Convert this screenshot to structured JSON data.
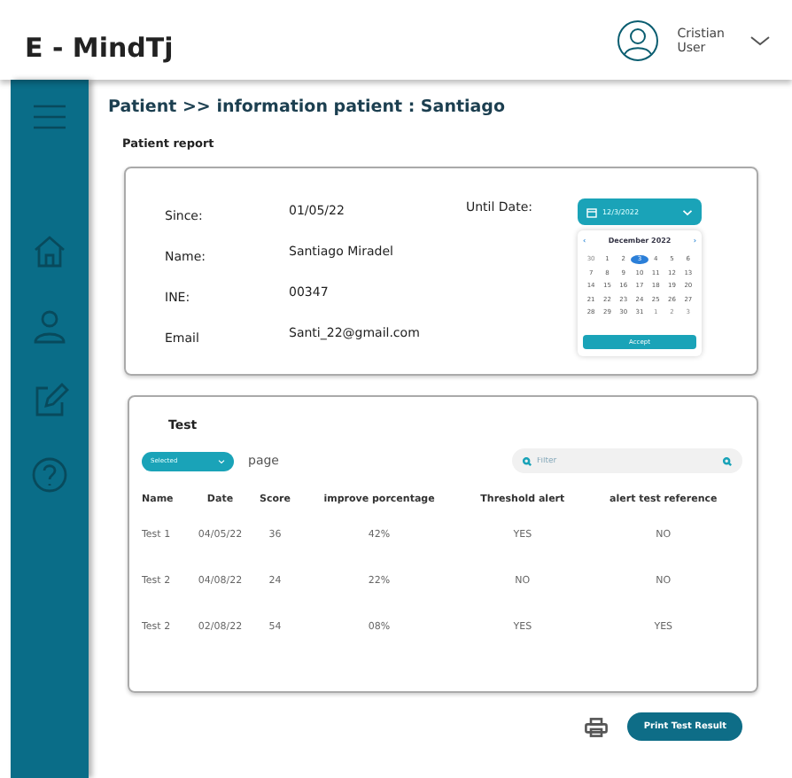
{
  "header": {
    "title": "E - MindTj",
    "user": {
      "name": "Cristian",
      "role": "User"
    }
  },
  "sidebar": {
    "items": [
      {
        "kind": "home"
      },
      {
        "kind": "person"
      },
      {
        "kind": "edit"
      },
      {
        "kind": "help"
      }
    ]
  },
  "breadcrumb": "Patient >> information patient : Santiago",
  "section_title": "Patient report",
  "patient": {
    "fields": [
      {
        "label": "Since:",
        "value": "01/05/22"
      },
      {
        "label": "Name:",
        "value": "Santiago Miradel"
      },
      {
        "label": "INE:",
        "value": "00347"
      },
      {
        "label": "Email",
        "value": "Santi_22@gmail.com"
      }
    ],
    "until_label": "Until Date:",
    "date_field": {
      "value": "12/3/2022"
    },
    "calendar": {
      "month": "December 2022",
      "prev": "‹",
      "next": "›",
      "days": [
        {
          "label": "30",
          "outside": true,
          "selected": false
        },
        {
          "label": "1",
          "outside": false,
          "selected": false
        },
        {
          "label": "2",
          "outside": false,
          "selected": false
        },
        {
          "label": "3",
          "outside": false,
          "selected": true
        },
        {
          "label": "4",
          "outside": false,
          "selected": false
        },
        {
          "label": "5",
          "outside": false,
          "selected": false
        },
        {
          "label": "6",
          "outside": false,
          "selected": false
        },
        {
          "label": "7",
          "outside": false,
          "selected": false
        },
        {
          "label": "8",
          "outside": false,
          "selected": false
        },
        {
          "label": "9",
          "outside": false,
          "selected": false
        },
        {
          "label": "10",
          "outside": false,
          "selected": false
        },
        {
          "label": "11",
          "outside": false,
          "selected": false
        },
        {
          "label": "12",
          "outside": false,
          "selected": false
        },
        {
          "label": "13",
          "outside": false,
          "selected": false
        },
        {
          "label": "14",
          "outside": false,
          "selected": false
        },
        {
          "label": "15",
          "outside": false,
          "selected": false
        },
        {
          "label": "16",
          "outside": false,
          "selected": false
        },
        {
          "label": "17",
          "outside": false,
          "selected": false
        },
        {
          "label": "18",
          "outside": false,
          "selected": false
        },
        {
          "label": "19",
          "outside": false,
          "selected": false
        },
        {
          "label": "20",
          "outside": false,
          "selected": false
        },
        {
          "label": "21",
          "outside": false,
          "selected": false
        },
        {
          "label": "22",
          "outside": false,
          "selected": false
        },
        {
          "label": "23",
          "outside": false,
          "selected": false
        },
        {
          "label": "24",
          "outside": false,
          "selected": false
        },
        {
          "label": "25",
          "outside": false,
          "selected": false
        },
        {
          "label": "26",
          "outside": false,
          "selected": false
        },
        {
          "label": "27",
          "outside": false,
          "selected": false
        },
        {
          "label": "28",
          "outside": false,
          "selected": false
        },
        {
          "label": "29",
          "outside": false,
          "selected": false
        },
        {
          "label": "30",
          "outside": false,
          "selected": false
        },
        {
          "label": "31",
          "outside": false,
          "selected": false
        },
        {
          "label": "1",
          "outside": true,
          "selected": false
        },
        {
          "label": "2",
          "outside": true,
          "selected": false
        },
        {
          "label": "3",
          "outside": true,
          "selected": false
        }
      ],
      "accept": "Accept"
    }
  },
  "tests": {
    "title": "Test",
    "page_select": "Selected",
    "page_label": "page",
    "filter": {
      "placeholder": "Filter"
    },
    "columns": [
      "Name",
      "Date",
      "Score",
      "improve porcentage",
      "Threshold alert",
      "alert test reference"
    ],
    "rows": [
      [
        "Test 1",
        "04/05/22",
        "36",
        "42%",
        "YES",
        "NO"
      ],
      [
        "Test 2",
        "04/08/22",
        "24",
        "22%",
        "NO",
        "NO"
      ],
      [
        "Test 2",
        "02/08/22",
        "54",
        "08%",
        "YES",
        "YES"
      ]
    ]
  },
  "print_button": "Print Test Result"
}
